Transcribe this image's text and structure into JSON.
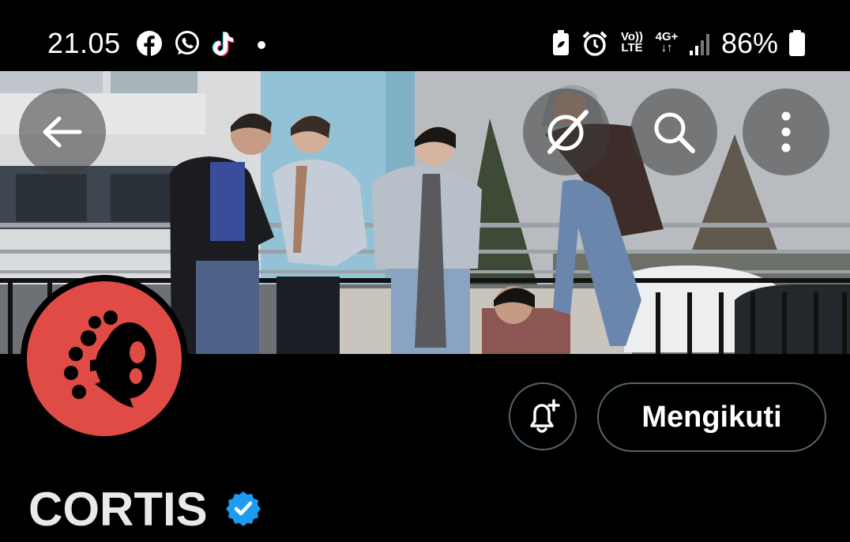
{
  "status_bar": {
    "time": "21.05",
    "left_icons": [
      "facebook-icon",
      "whatsapp-icon",
      "tiktok-icon",
      "notification-dot"
    ],
    "right_icons": [
      "battery-saver-icon",
      "alarm-icon",
      "volte-icon",
      "4g-data-icon",
      "signal-icon",
      "battery-icon"
    ],
    "volte_label": "Vo))\nLTE",
    "network_label": "4G+",
    "battery_percent": "86%"
  },
  "header": {
    "back_icon": "arrow-left-icon",
    "grok_icon": "grok-icon",
    "search_icon": "search-icon",
    "more_icon": "more-vertical-icon"
  },
  "profile": {
    "name": "CORTIS",
    "verified": true,
    "avatar_color": "#e04b45",
    "follow_label": "Mengikuti",
    "notification_icon": "bell-plus-icon"
  },
  "colors": {
    "background": "#000000",
    "button_border": "#536471",
    "verified_blue": "#1d9bf0"
  }
}
